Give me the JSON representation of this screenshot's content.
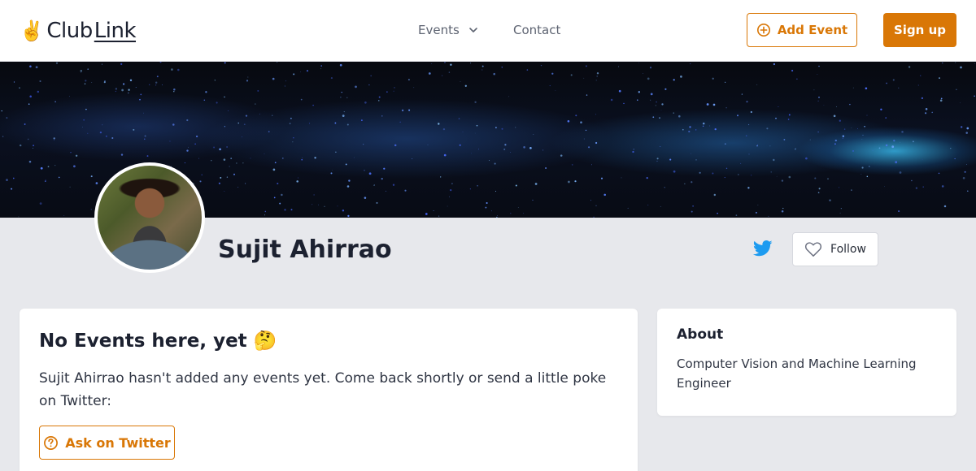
{
  "header": {
    "logo_hand": "✌️",
    "logo_club": "Club",
    "logo_link": "Link",
    "nav": {
      "events_label": "Events",
      "contact_label": "Contact"
    },
    "add_event_label": "Add Event",
    "signup_label": "Sign up"
  },
  "profile": {
    "name": "Sujit Ahirrao",
    "follow_label": "Follow"
  },
  "events_card": {
    "title": "No Events here, yet",
    "title_emoji": "🤔",
    "message": "Sujit Ahirrao hasn't added any events yet. Come back shortly or send a little poke on Twitter:",
    "ask_button_label": "Ask on Twitter"
  },
  "about_card": {
    "title": "About",
    "text": "Computer Vision and Machine Learning Engineer"
  },
  "colors": {
    "accent": "#d97706",
    "twitter": "#1d9bf0",
    "page_bg": "#e7e8ec"
  },
  "icons": {
    "add_event": "plus-circle-icon",
    "events_dropdown": "chevron-down-icon",
    "twitter": "twitter-bird-icon",
    "follow": "heart-outline-icon",
    "ask": "question-circle-icon"
  }
}
